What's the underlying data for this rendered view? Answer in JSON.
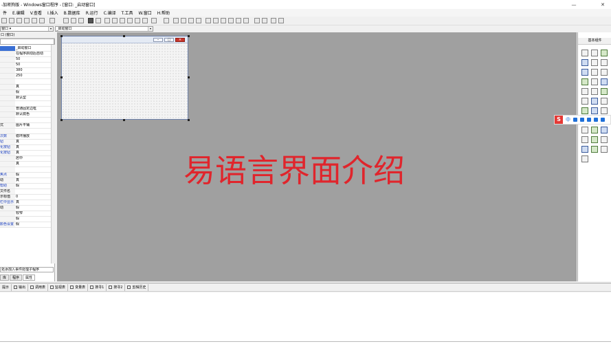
{
  "window": {
    "title": "-加密狗版 - Windows窗口程序 - [窗口: _启动窗口]",
    "min": "—",
    "close": "✕"
  },
  "menu": [
    "件",
    "E.编辑",
    "V.查看",
    "I.插入",
    "B.数据库",
    "R.运行",
    "C.编译",
    "T.工具",
    "W.窗口",
    "H.帮助"
  ],
  "combos": {
    "left": "窗口 ▾",
    "right": "_启动窗口"
  },
  "properties": {
    "header": "口 (窗口)",
    "object_combo": "",
    "rows": [
      {
        "k": "",
        "v": "_启动窗口"
      },
      {
        "k": "",
        "v": "在程序启动后自动"
      },
      {
        "k": "",
        "v": "50"
      },
      {
        "k": "",
        "v": "50"
      },
      {
        "k": "",
        "v": "380"
      },
      {
        "k": "",
        "v": "250"
      },
      {
        "k": "",
        "v": ""
      },
      {
        "k": "",
        "v": "真"
      },
      {
        "k": "",
        "v": "假"
      },
      {
        "k": "",
        "v": "默认型"
      },
      {
        "k": "",
        "v": ""
      },
      {
        "k": "",
        "v": "普通固定边框"
      },
      {
        "k": "",
        "v": "默认底色"
      },
      {
        "k": "",
        "v": ""
      },
      {
        "k": "式",
        "v": "图片平铺"
      },
      {
        "k": "",
        "v": ""
      },
      {
        "k": "次数",
        "v": "循环播放"
      },
      {
        "k": "钮",
        "v": "真"
      },
      {
        "k": "化按钮",
        "v": "真"
      },
      {
        "k": "化按钮",
        "v": "真"
      },
      {
        "k": "",
        "v": "居中"
      },
      {
        "k": "",
        "v": "真"
      },
      {
        "k": "",
        "v": ""
      },
      {
        "k": "焦点",
        "v": "假"
      },
      {
        "k": "动",
        "v": "真"
      },
      {
        "k": "帮助",
        "v": "假"
      },
      {
        "k": "文件名",
        "v": ""
      },
      {
        "k": "示标值",
        "v": "0"
      },
      {
        "k": "栏中显示",
        "v": "真"
      },
      {
        "k": "动",
        "v": "假"
      },
      {
        "k": "",
        "v": "较窄"
      },
      {
        "k": "",
        "v": "假"
      },
      {
        "k": "颜色设置",
        "v": "假"
      }
    ],
    "hint": "处添加入事件处理子程序",
    "tabs": [
      "库",
      "程序",
      "属性"
    ]
  },
  "overlay_caption": "易语言界面介绍",
  "components": {
    "title": "基本组件"
  },
  "ime": {
    "logo": "S",
    "mode": "中"
  },
  "bottom_tabs": [
    "提示",
    "输出",
    "调用表",
    "监视表",
    "变量表",
    "搜寻1",
    "搜寻2",
    "剪辑历史"
  ]
}
